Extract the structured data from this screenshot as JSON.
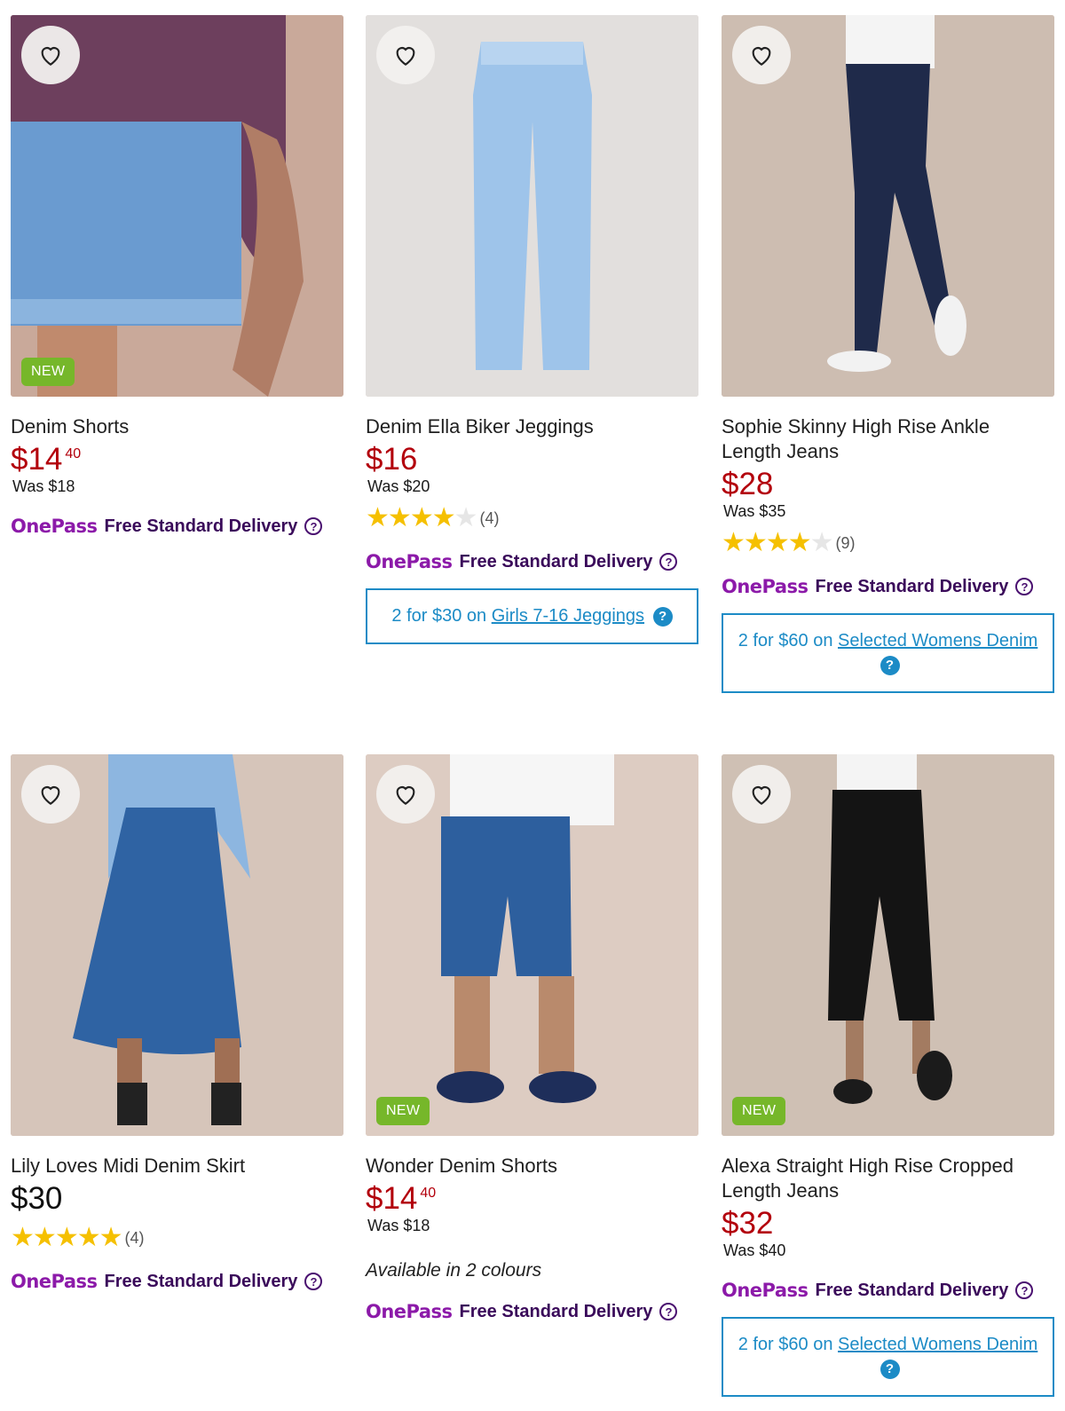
{
  "colors": {
    "sale_price": "#b3000c",
    "onepass": "#8c1aa9",
    "promo": "#1c8bc6",
    "new_badge": "#76b72a",
    "star": "#f5c000"
  },
  "icons": {
    "wishlist": "heart-icon",
    "info": "help-circle-icon"
  },
  "onepass": {
    "brand": "OnePass",
    "delivery": "Free Standard Delivery",
    "info_glyph": "?"
  },
  "products": [
    {
      "title": "Denim Shorts",
      "price": "$14",
      "cents": "40",
      "was": "Was $18",
      "badge": "NEW"
    },
    {
      "title": "Denim Ella Biker Jeggings",
      "price": "$16",
      "was": "Was $20",
      "rating": 4,
      "count": "(4)",
      "promo": {
        "lead": "2 for $30 on",
        "link": "Girls 7-16 Jeggings"
      }
    },
    {
      "title": "Sophie Skinny High Rise Ankle Length Jeans",
      "price": "$28",
      "was": "Was $35",
      "rating": 4,
      "count": "(9)",
      "promo": {
        "lead": "2 for $60 on",
        "link": "Selected Womens Denim"
      }
    },
    {
      "title": "Lily Loves Midi Denim Skirt",
      "price": "$30",
      "rating": 5,
      "count": "(4)"
    },
    {
      "title": "Wonder Denim Shorts",
      "price": "$14",
      "cents": "40",
      "was": "Was $18",
      "badge": "NEW",
      "colours": "Available in 2 colours"
    },
    {
      "title": "Alexa Straight High Rise Cropped Length Jeans",
      "price": "$32",
      "was": "Was $40",
      "badge": "NEW",
      "promo": {
        "lead": "2 for $60 on",
        "link": "Selected Womens Denim"
      }
    }
  ]
}
